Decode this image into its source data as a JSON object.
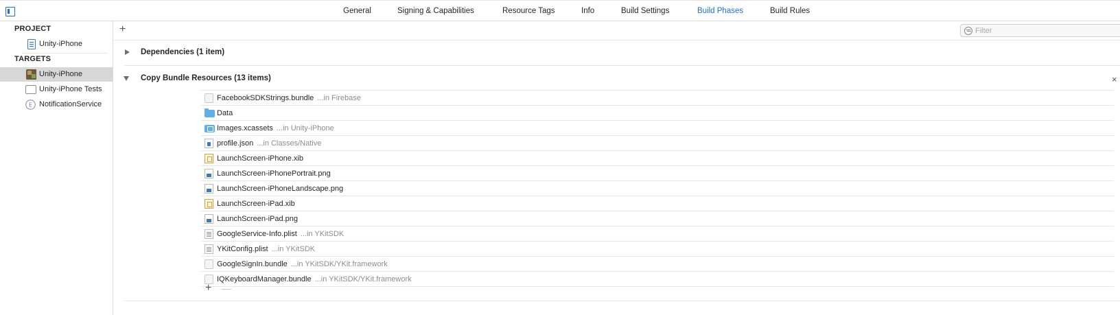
{
  "toolbar": {
    "tabs": [
      {
        "label": "General"
      },
      {
        "label": "Signing & Capabilities"
      },
      {
        "label": "Resource Tags"
      },
      {
        "label": "Info"
      },
      {
        "label": "Build Settings"
      },
      {
        "label": "Build Phases",
        "active": true
      },
      {
        "label": "Build Rules"
      }
    ],
    "accent_color": "#1d6fe0"
  },
  "sidebar": {
    "project_header": "PROJECT",
    "project_item": {
      "label": "Unity-iPhone",
      "icon": "project-file-icon"
    },
    "targets_header": "TARGETS",
    "targets": [
      {
        "label": "Unity-iPhone",
        "icon": "app-icon",
        "selected": true
      },
      {
        "label": "Unity-iPhone Tests",
        "icon": "test-bundle-icon"
      },
      {
        "label": "NotificationService",
        "icon": "extension-icon"
      }
    ]
  },
  "main": {
    "filter_placeholder": "Filter",
    "phases": [
      {
        "title": "Dependencies (1 item)",
        "expanded": false
      },
      {
        "title": "Copy Bundle Resources (13 items)",
        "expanded": true
      }
    ],
    "resources": [
      {
        "name": "FacebookSDKStrings.bundle",
        "location": "...in Firebase",
        "icon": "bundle-icon"
      },
      {
        "name": "Data",
        "location": "",
        "icon": "folder-icon"
      },
      {
        "name": "Images.xcassets",
        "location": "...in Unity-iPhone",
        "icon": "asset-catalog-icon"
      },
      {
        "name": "profile.json",
        "location": "...in Classes/Native",
        "icon": "json-file-icon"
      },
      {
        "name": "LaunchScreen-iPhone.xib",
        "location": "",
        "icon": "xib-file-icon"
      },
      {
        "name": "LaunchScreen-iPhonePortrait.png",
        "location": "",
        "icon": "png-file-icon"
      },
      {
        "name": "LaunchScreen-iPhoneLandscape.png",
        "location": "",
        "icon": "png-file-icon"
      },
      {
        "name": "LaunchScreen-iPad.xib",
        "location": "",
        "icon": "xib-file-icon"
      },
      {
        "name": "LaunchScreen-iPad.png",
        "location": "",
        "icon": "png-file-icon"
      },
      {
        "name": "GoogleService-Info.plist",
        "location": "...in YKitSDK",
        "icon": "plist-file-icon"
      },
      {
        "name": "YKitConfig.plist",
        "location": "...in YKitSDK",
        "icon": "plist-file-icon"
      },
      {
        "name": "GoogleSignIn.bundle",
        "location": "...in YKitSDK/YKit.framework",
        "icon": "bundle-icon"
      },
      {
        "name": "IQKeyboardManager.bundle",
        "location": "...in YKitSDK/YKit.framework",
        "icon": "bundle-icon"
      }
    ]
  }
}
